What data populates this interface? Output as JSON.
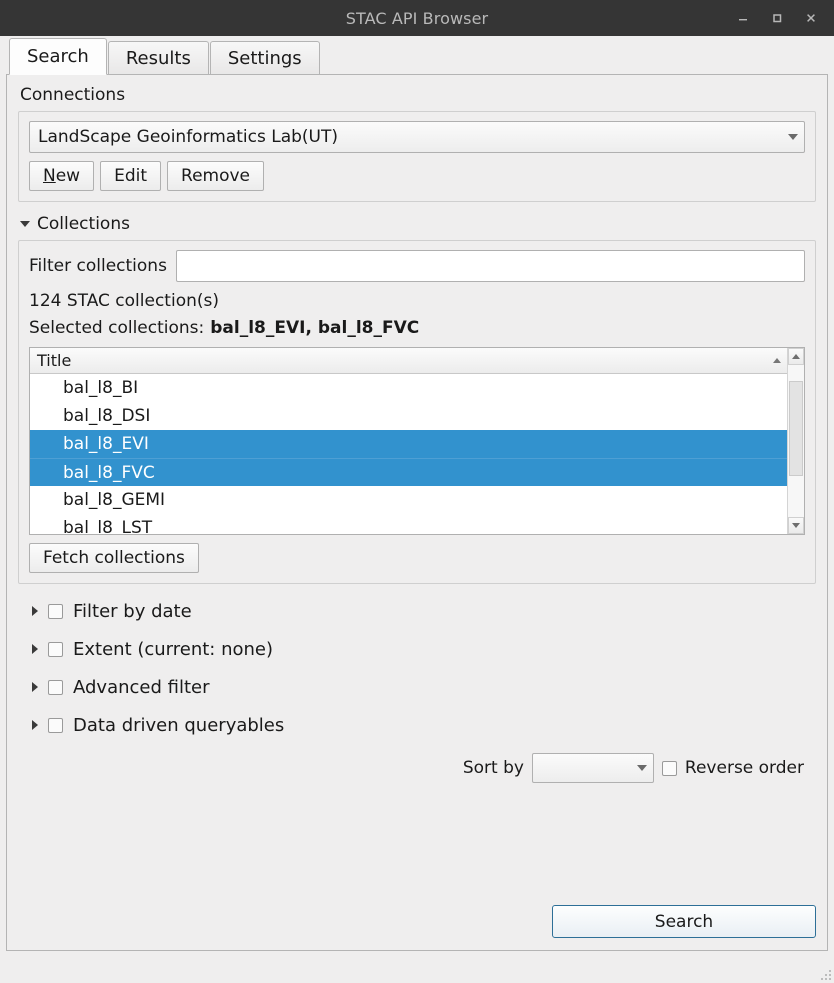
{
  "window": {
    "title": "STAC API Browser",
    "controls": [
      {
        "name": "minimize",
        "glyph": "–"
      },
      {
        "name": "maximize",
        "glyph": "□"
      },
      {
        "name": "close",
        "glyph": "×"
      }
    ]
  },
  "tabs": [
    {
      "label": "Search",
      "active": true
    },
    {
      "label": "Results",
      "active": false
    },
    {
      "label": "Settings",
      "active": false
    }
  ],
  "connections": {
    "group_label": "Connections",
    "selected_connection": "LandScape Geoinformatics Lab(UT)",
    "buttons": {
      "new": "New",
      "new_mnemonic": "N",
      "edit": "Edit",
      "remove": "Remove"
    }
  },
  "collections": {
    "group_label": "Collections",
    "expanded": true,
    "filter_label": "Filter collections",
    "filter_value": "",
    "filter_placeholder": "",
    "count_text": "124 STAC collection(s)",
    "selected_label": "Selected collections:",
    "selected_values": "bal_l8_EVI, bal_l8_FVC",
    "list_header": "Title",
    "sort_direction": "ascending",
    "items": [
      {
        "title": "bal_l8_BI",
        "selected": false
      },
      {
        "title": "bal_l8_DSI",
        "selected": false
      },
      {
        "title": "bal_l8_EVI",
        "selected": true
      },
      {
        "title": "bal_l8_FVC",
        "selected": true
      },
      {
        "title": "bal_l8_GEMI",
        "selected": false
      },
      {
        "title": "bal_l8_LST",
        "selected": false
      }
    ],
    "fetch_button": "Fetch collections"
  },
  "filter_sections": [
    {
      "label": "Filter by date",
      "checked": false,
      "expanded": false
    },
    {
      "label": "Extent (current: none)",
      "checked": false,
      "expanded": false
    },
    {
      "label": "Advanced filter",
      "checked": false,
      "expanded": false
    },
    {
      "label": "Data driven queryables",
      "checked": false,
      "expanded": false
    }
  ],
  "sort": {
    "label": "Sort by",
    "value": "",
    "reverse_label": "Reverse order",
    "reverse_checked": false
  },
  "actions": {
    "search_button": "Search"
  },
  "colors": {
    "titlebar_bg": "#353535",
    "titlebar_text": "#b9b9b9",
    "window_bg": "#efeeee",
    "selection_blue": "#3292ce",
    "default_button_border": "#2d6f97"
  }
}
